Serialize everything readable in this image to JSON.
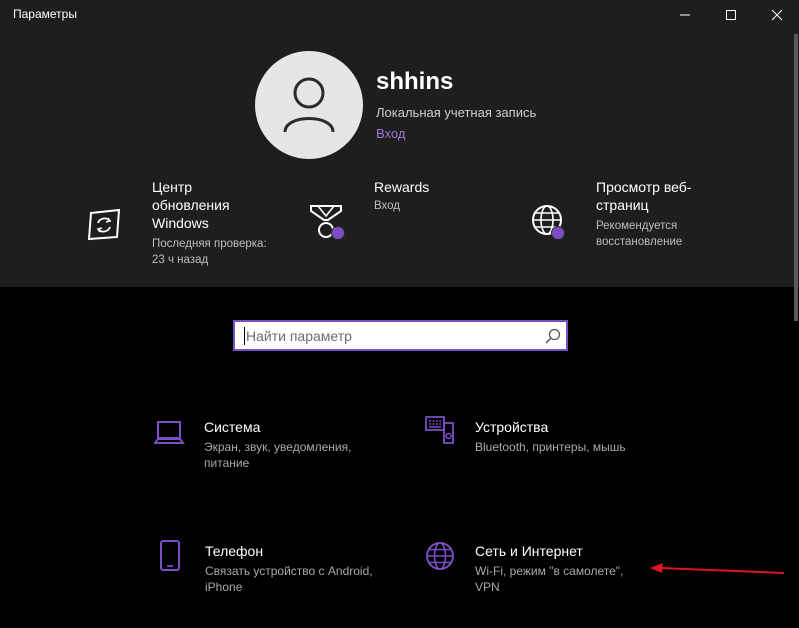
{
  "window": {
    "title": "Параметры"
  },
  "account": {
    "username": "shhins",
    "account_type": "Локальная учетная запись",
    "signin_link": "Вход"
  },
  "tiles": [
    {
      "title": "Центр обновления Windows",
      "subtitle": "Последняя проверка: 23 ч назад",
      "icon": "windows-update-icon"
    },
    {
      "title": "Rewards",
      "subtitle": "Вход",
      "icon": "rewards-medal-icon"
    },
    {
      "title": "Просмотр веб-страниц",
      "subtitle": "Рекомендуется восстановление",
      "icon": "globe-icon"
    }
  ],
  "search": {
    "placeholder": "Найти параметр"
  },
  "categories": [
    {
      "title": "Система",
      "subtitle": "Экран, звук, уведомления, питание",
      "icon": "laptop-icon"
    },
    {
      "title": "Устройства",
      "subtitle": "Bluetooth, принтеры, мышь",
      "icon": "devices-icon"
    },
    {
      "title": "Телефон",
      "subtitle": "Связать устройство с Android, iPhone",
      "icon": "phone-icon"
    },
    {
      "title": "Сеть и Интернет",
      "subtitle": "Wi-Fi, режим \"в самолете\", VPN",
      "icon": "network-globe-icon"
    }
  ],
  "colors": {
    "accent": "#7b4fc4",
    "header_bg": "#1f1e1f",
    "page_bg": "#000000",
    "annotation_arrow": "#e0141e"
  }
}
